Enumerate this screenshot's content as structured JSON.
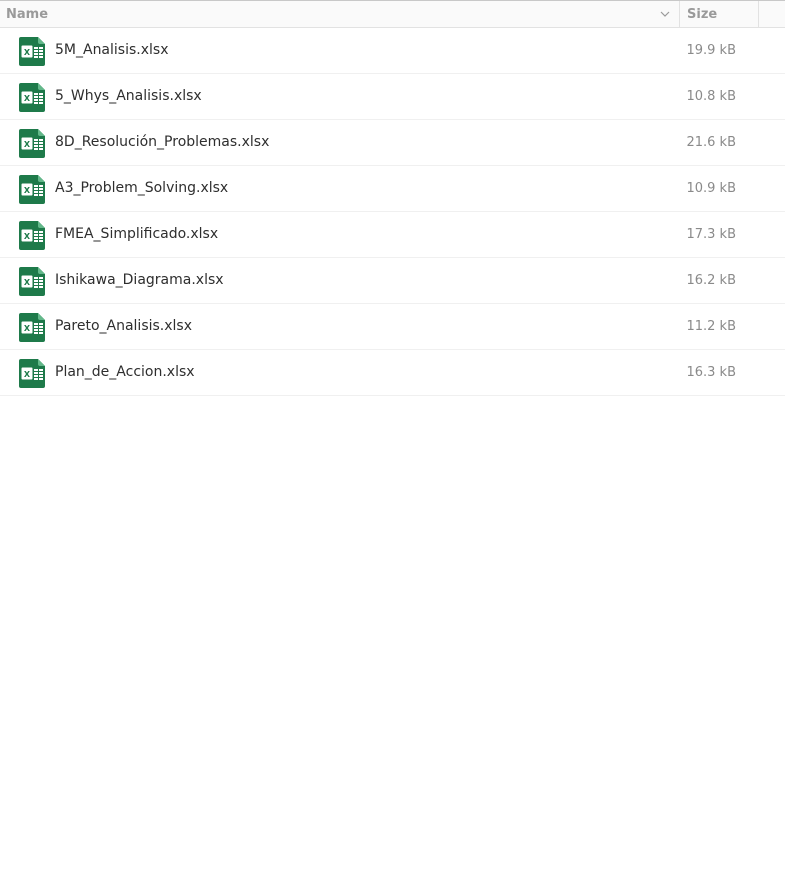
{
  "columns": {
    "name": "Name",
    "size": "Size"
  },
  "icons": {
    "sort": "chevron-down-icon",
    "file": "spreadsheet-icon"
  },
  "colors": {
    "spreadsheet_green": "#1e7a4a",
    "spreadsheet_light": "#2f9a62",
    "header_text": "#9a9a9a",
    "size_text": "#8a8a8a"
  },
  "files": [
    {
      "name": "5M_Analisis.xlsx",
      "size": "19.9 kB"
    },
    {
      "name": "5_Whys_Analisis.xlsx",
      "size": "10.8 kB"
    },
    {
      "name": "8D_Resolución_Problemas.xlsx",
      "size": "21.6 kB"
    },
    {
      "name": "A3_Problem_Solving.xlsx",
      "size": "10.9 kB"
    },
    {
      "name": "FMEA_Simplificado.xlsx",
      "size": "17.3 kB"
    },
    {
      "name": "Ishikawa_Diagrama.xlsx",
      "size": "16.2 kB"
    },
    {
      "name": "Pareto_Analisis.xlsx",
      "size": "11.2 kB"
    },
    {
      "name": "Plan_de_Accion.xlsx",
      "size": "16.3 kB"
    }
  ]
}
